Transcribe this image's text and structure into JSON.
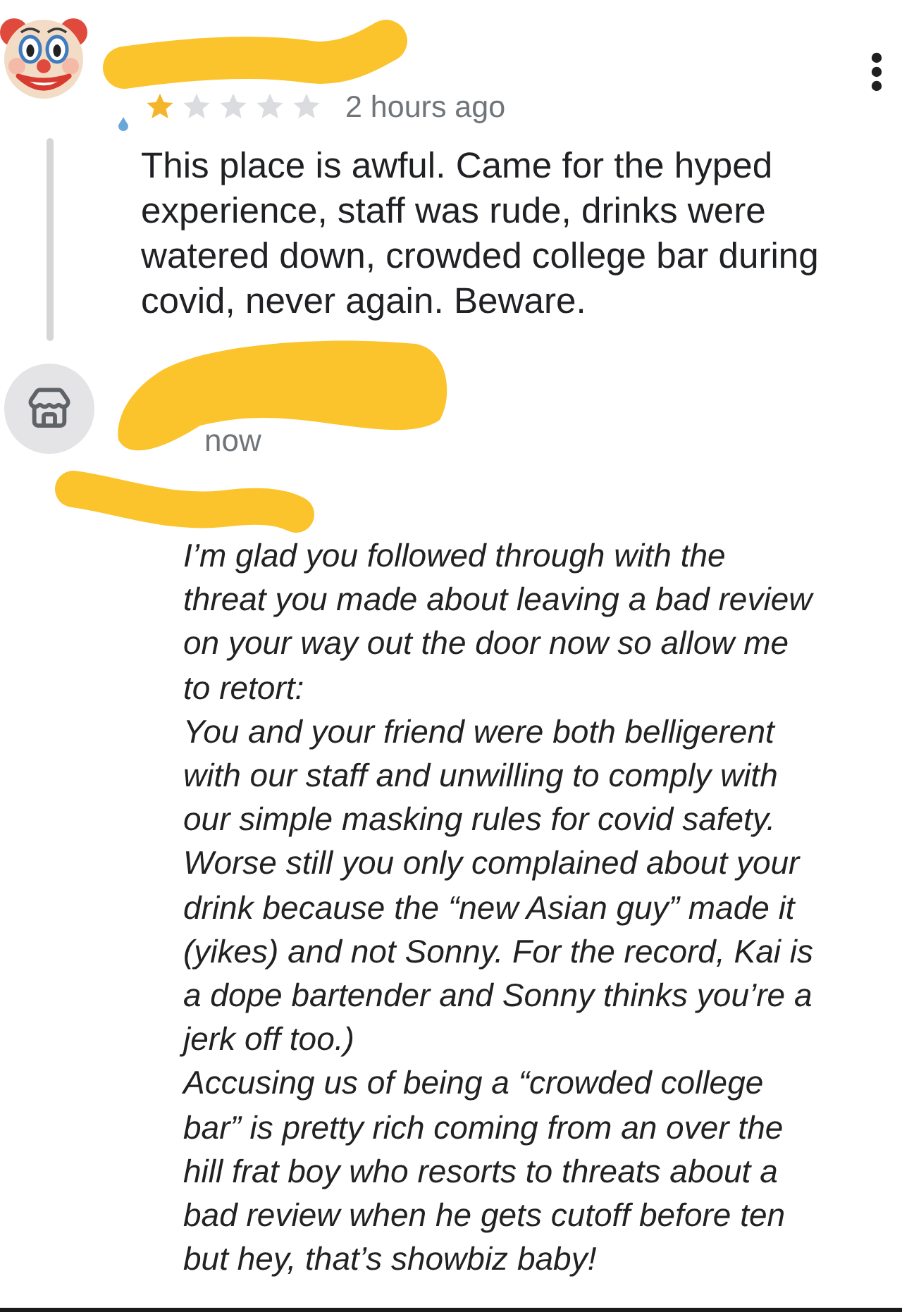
{
  "review": {
    "stars": 1,
    "time": "2 hours ago",
    "text": "This place is awful. Came for the hyped experience, staff was rude, drinks were watered down, crowded college bar during covid, never again. Beware."
  },
  "reply": {
    "time": "now",
    "paragraphs": [
      "I’m glad you followed through with the threat you made about leaving a bad review on your way out the door now so allow me to retort:",
      "You and your friend were both belligerent with our staff and unwilling to comply with our simple masking rules for covid safety. Worse still you only complained about your drink because the “new Asian guy” made it (yikes) and not Sonny. For the record, Kai is a dope bartender and Sonny thinks you’re a jerk off too.)",
      "Accusing us of being a “crowded college bar” is pretty rich coming from an over the hill frat boy who resorts to threats about a bad review when he gets cutoff before ten but hey, that’s showbiz baby!"
    ]
  }
}
